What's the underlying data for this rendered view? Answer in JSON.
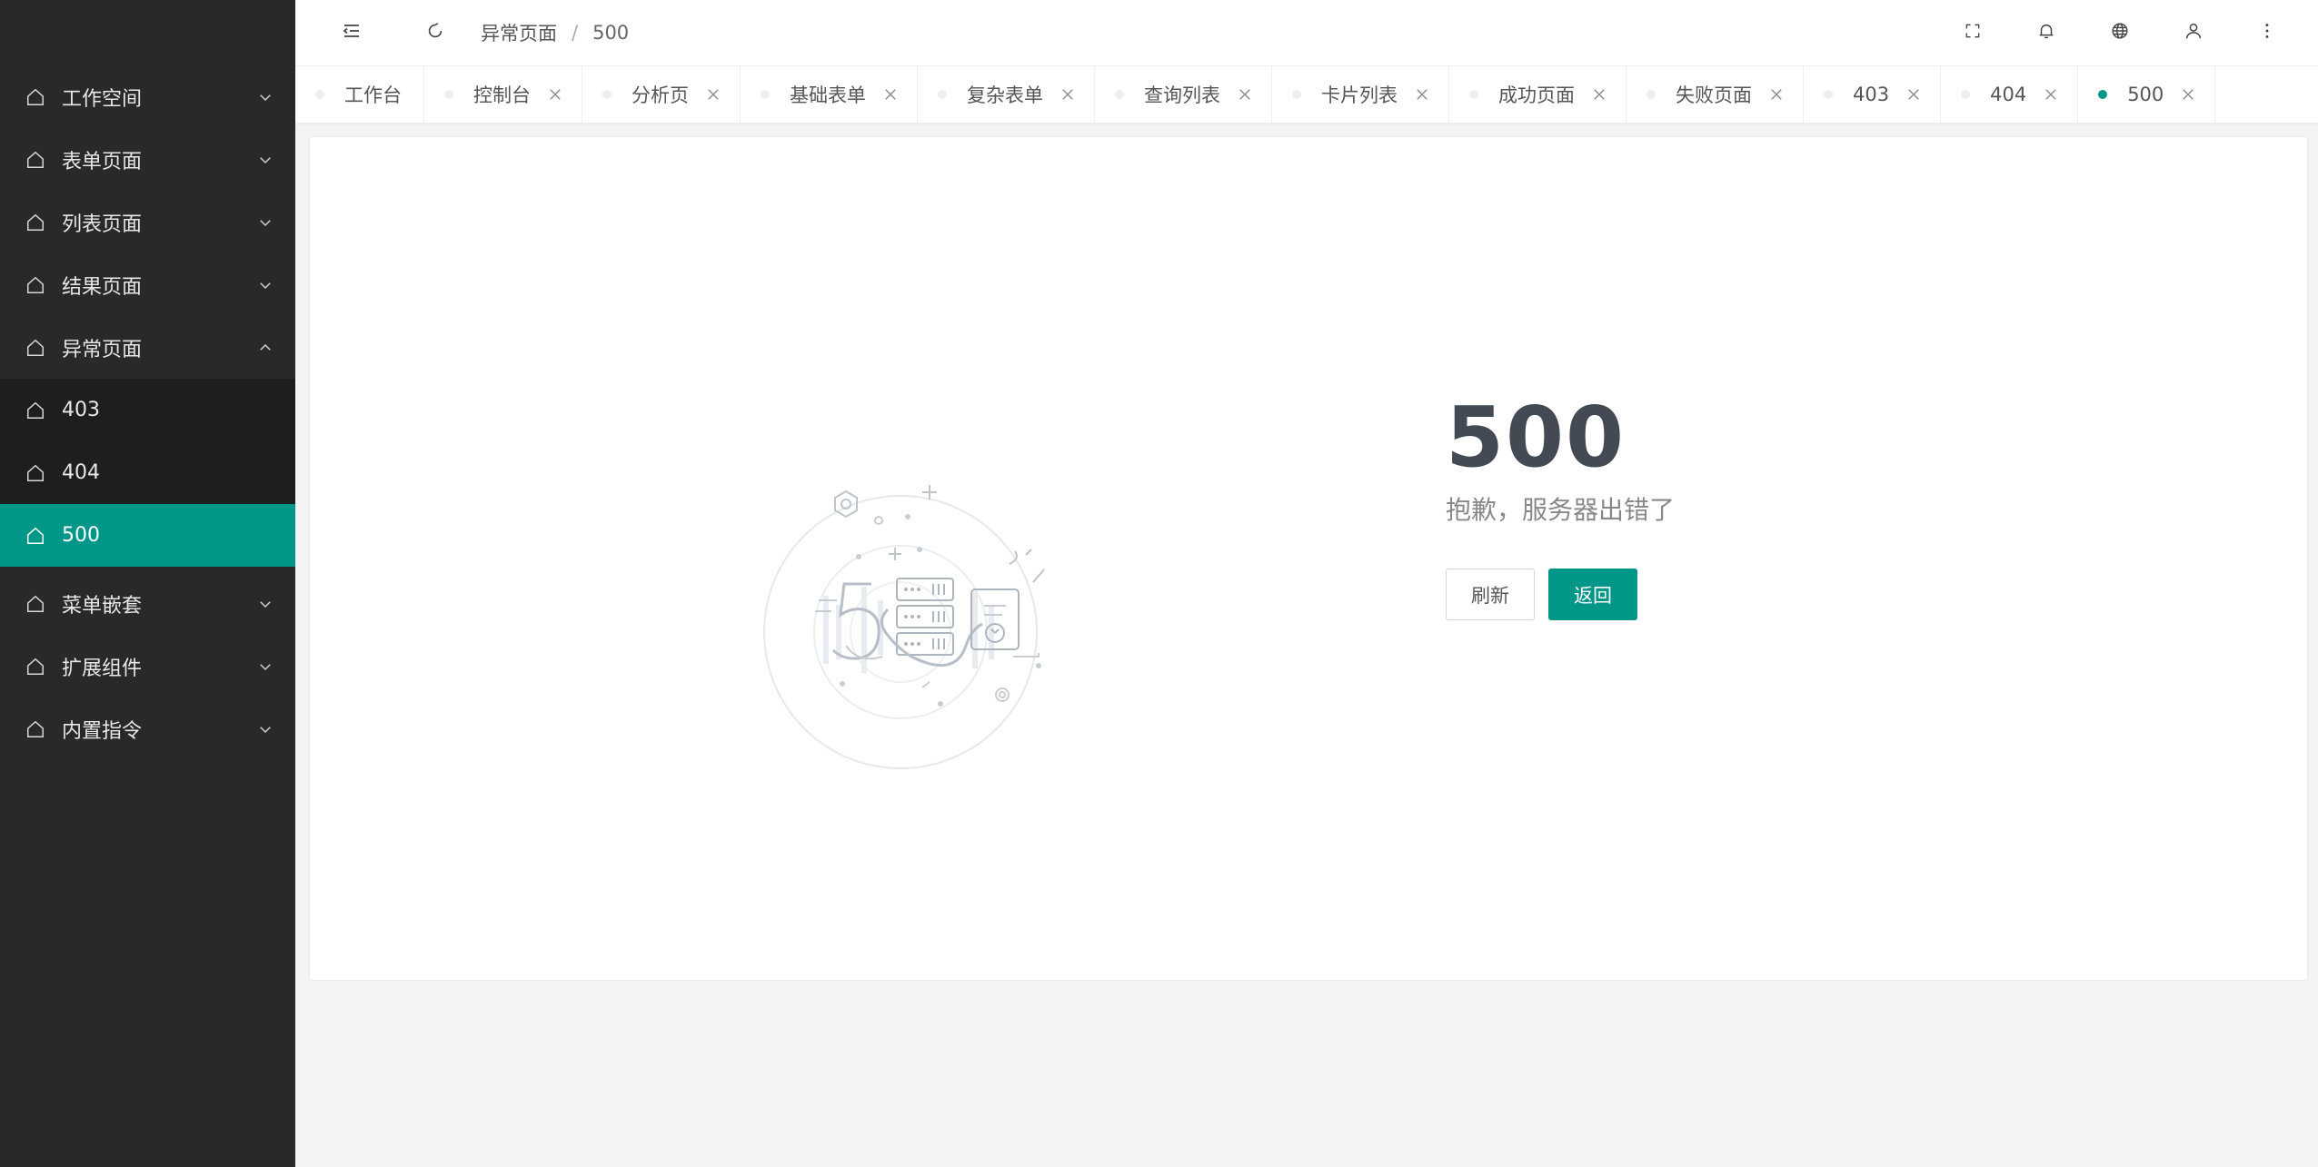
{
  "sidebar": {
    "menu": [
      {
        "label": "工作空间"
      },
      {
        "label": "表单页面"
      },
      {
        "label": "列表页面"
      },
      {
        "label": "结果页面"
      },
      {
        "label": "异常页面"
      }
    ],
    "submenu": [
      {
        "label": "403"
      },
      {
        "label": "404"
      },
      {
        "label": "500"
      }
    ],
    "menu_after": [
      {
        "label": "菜单嵌套"
      },
      {
        "label": "扩展组件"
      },
      {
        "label": "内置指令"
      }
    ]
  },
  "header": {
    "breadcrumb": [
      "异常页面",
      "500"
    ],
    "breadcrumb_sep": "/"
  },
  "tabs": [
    {
      "label": "工作台"
    },
    {
      "label": "控制台"
    },
    {
      "label": "分析页"
    },
    {
      "label": "基础表单"
    },
    {
      "label": "复杂表单"
    },
    {
      "label": "查询列表"
    },
    {
      "label": "卡片列表"
    },
    {
      "label": "成功页面"
    },
    {
      "label": "失败页面"
    },
    {
      "label": "403"
    },
    {
      "label": "404"
    },
    {
      "label": "500"
    }
  ],
  "error": {
    "code": "500",
    "description": "抱歉，服务器出错了",
    "refresh_label": "刷新",
    "back_label": "返回"
  },
  "colors": {
    "accent": "#009688",
    "sidebar_bg": "#28292b",
    "submenu_bg": "#1d1e1f",
    "code_text": "#434a54"
  },
  "icons": {
    "menu_item": "home-outline-icon",
    "collapse": "menu-fold-icon",
    "refresh": "refresh-icon",
    "fullscreen": "fullscreen-icon",
    "notification": "bell-icon",
    "language": "globe-icon",
    "user": "user-icon",
    "more": "more-vertical-icon"
  }
}
